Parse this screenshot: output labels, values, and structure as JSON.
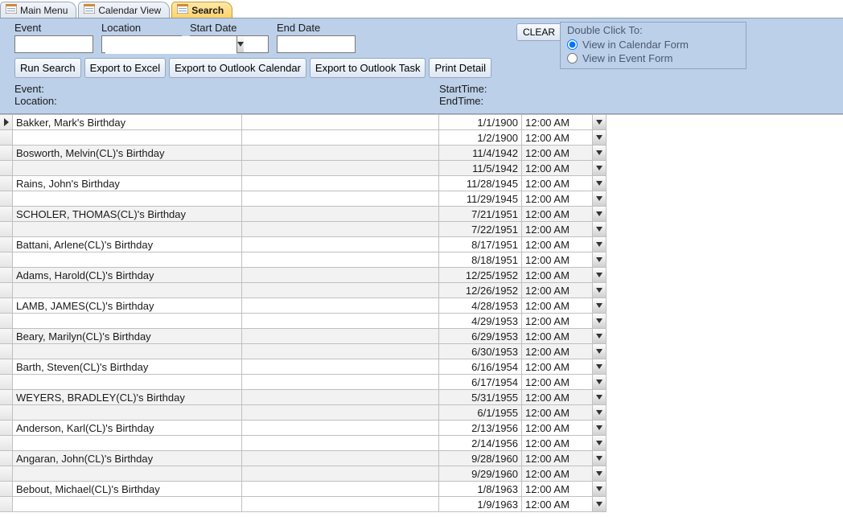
{
  "tabs": [
    {
      "label": "Main Menu",
      "active": false
    },
    {
      "label": "Calendar View",
      "active": false
    },
    {
      "label": "Search",
      "active": true
    }
  ],
  "filters": {
    "event_label": "Event",
    "location_label": "Location",
    "startdate_label": "Start Date",
    "enddate_label": "End Date",
    "event_value": "",
    "location_value": "",
    "startdate_value": "",
    "enddate_value": ""
  },
  "clear_label": "CLEAR",
  "dblclick": {
    "header": "Double Click To:",
    "opt1": "View in Calendar Form",
    "opt2": "View in Event Form",
    "selected": "calendar"
  },
  "actions": {
    "run_search": "Run Search",
    "export_excel": "Export to Excel",
    "export_outlook_cal": "Export to Outlook Calendar",
    "export_outlook_task": "Export to Outlook Task",
    "print_detail": "Print Detail"
  },
  "detail": {
    "event_label": "Event:",
    "location_label": "Location:",
    "start_label": "StartTime:",
    "end_label": "EndTime:"
  },
  "rows": [
    {
      "event": "Bakker, Mark's Birthday",
      "location": "",
      "date": "1/1/1900",
      "time": "12:00 AM",
      "cur": true
    },
    {
      "event": "",
      "location": "",
      "date": "1/2/1900",
      "time": "12:00 AM"
    },
    {
      "event": "Bosworth, Melvin(CL)'s Birthday",
      "location": "",
      "date": "11/4/1942",
      "time": "12:00 AM"
    },
    {
      "event": "",
      "location": "",
      "date": "11/5/1942",
      "time": "12:00 AM"
    },
    {
      "event": "Rains, John's Birthday",
      "location": "",
      "date": "11/28/1945",
      "time": "12:00 AM"
    },
    {
      "event": "",
      "location": "",
      "date": "11/29/1945",
      "time": "12:00 AM"
    },
    {
      "event": "SCHOLER, THOMAS(CL)'s Birthday",
      "location": "",
      "date": "7/21/1951",
      "time": "12:00 AM"
    },
    {
      "event": "",
      "location": "",
      "date": "7/22/1951",
      "time": "12:00 AM"
    },
    {
      "event": "Battani, Arlene(CL)'s Birthday",
      "location": "",
      "date": "8/17/1951",
      "time": "12:00 AM"
    },
    {
      "event": "",
      "location": "",
      "date": "8/18/1951",
      "time": "12:00 AM"
    },
    {
      "event": "Adams, Harold(CL)'s Birthday",
      "location": "",
      "date": "12/25/1952",
      "time": "12:00 AM"
    },
    {
      "event": "",
      "location": "",
      "date": "12/26/1952",
      "time": "12:00 AM"
    },
    {
      "event": "LAMB, JAMES(CL)'s Birthday",
      "location": "",
      "date": "4/28/1953",
      "time": "12:00 AM"
    },
    {
      "event": "",
      "location": "",
      "date": "4/29/1953",
      "time": "12:00 AM"
    },
    {
      "event": "Beary, Marilyn(CL)'s Birthday",
      "location": "",
      "date": "6/29/1953",
      "time": "12:00 AM"
    },
    {
      "event": "",
      "location": "",
      "date": "6/30/1953",
      "time": "12:00 AM"
    },
    {
      "event": "Barth, Steven(CL)'s Birthday",
      "location": "",
      "date": "6/16/1954",
      "time": "12:00 AM"
    },
    {
      "event": "",
      "location": "",
      "date": "6/17/1954",
      "time": "12:00 AM"
    },
    {
      "event": "WEYERS, BRADLEY(CL)'s Birthday",
      "location": "",
      "date": "5/31/1955",
      "time": "12:00 AM"
    },
    {
      "event": "",
      "location": "",
      "date": "6/1/1955",
      "time": "12:00 AM"
    },
    {
      "event": "Anderson, Karl(CL)'s Birthday",
      "location": "",
      "date": "2/13/1956",
      "time": "12:00 AM"
    },
    {
      "event": "",
      "location": "",
      "date": "2/14/1956",
      "time": "12:00 AM"
    },
    {
      "event": "Angaran, John(CL)'s Birthday",
      "location": "",
      "date": "9/28/1960",
      "time": "12:00 AM"
    },
    {
      "event": "",
      "location": "",
      "date": "9/29/1960",
      "time": "12:00 AM"
    },
    {
      "event": "Bebout, Michael(CL)'s Birthday",
      "location": "",
      "date": "1/8/1963",
      "time": "12:00 AM"
    },
    {
      "event": "",
      "location": "",
      "date": "1/9/1963",
      "time": "12:00 AM"
    }
  ]
}
